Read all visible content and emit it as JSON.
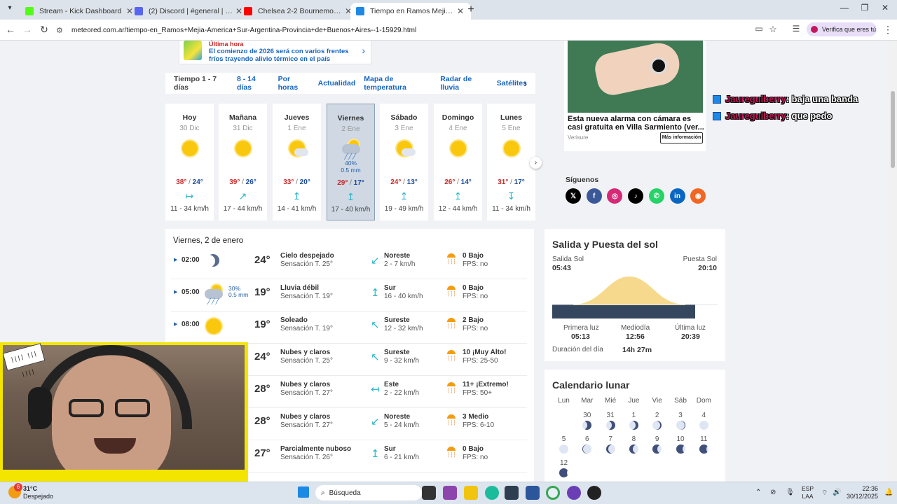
{
  "browser": {
    "tabs": [
      {
        "title": "Stream - Kick Dashboard",
        "color": "#53fc18"
      },
      {
        "title": "(2) Discord | #general | Liberisc",
        "color": "#5865f2"
      },
      {
        "title": "Chelsea 2-2 Bournemouth | HIG",
        "color": "#ff0000"
      },
      {
        "title": "Tiempo en Ramos Mejia. Clima",
        "color": "#1e88e5"
      }
    ],
    "url": "meteored.com.ar/tiempo-en_Ramos+Mejia-America+Sur-Argentina-Provincia+de+Buenos+Aires--1-15929.html",
    "profile_label": "Verifica que eres tú"
  },
  "news": {
    "tag": "Última hora",
    "headline": "El comienzo de 2026 será con varios frentes fríos trayendo alivio térmico en el país"
  },
  "subnav": [
    "Tiempo 1 - 7 días",
    "8 - 14 días",
    "Por horas",
    "Actualidad",
    "Mapa de temperatura",
    "Radar de lluvia",
    "Satélites"
  ],
  "days": [
    {
      "name": "Hoy",
      "date": "30 Dic",
      "icon": "sun",
      "hi": "38°",
      "lo": "24°",
      "wind_arrow": "↦",
      "wind": "11 - 34 km/h"
    },
    {
      "name": "Mañana",
      "date": "31 Dic",
      "icon": "sun",
      "hi": "39°",
      "lo": "26°",
      "wind_arrow": "↗",
      "wind": "17 - 44 km/h"
    },
    {
      "name": "Jueves",
      "date": "1 Ene",
      "icon": "sun-cloud",
      "hi": "33°",
      "lo": "20°",
      "wind_arrow": "↥",
      "wind": "14 - 41 km/h"
    },
    {
      "name": "Viernes",
      "date": "2 Ene",
      "icon": "rain",
      "precip": "40%",
      "precip_mm": "0.5 mm",
      "hi": "29°",
      "lo": "17°",
      "wind_arrow": "↥",
      "wind": "17 - 40 km/h"
    },
    {
      "name": "Sábado",
      "date": "3 Ene",
      "icon": "sun-cloud",
      "hi": "24°",
      "lo": "13°",
      "wind_arrow": "↥",
      "wind": "19 - 49 km/h"
    },
    {
      "name": "Domingo",
      "date": "4 Ene",
      "icon": "sun",
      "hi": "26°",
      "lo": "14°",
      "wind_arrow": "↥",
      "wind": "12 - 44 km/h"
    },
    {
      "name": "Lunes",
      "date": "5 Ene",
      "icon": "sun",
      "hi": "31°",
      "lo": "17°",
      "wind_arrow": "↧",
      "wind": "11 - 34 km/h"
    }
  ],
  "detail": {
    "title": "Viernes, 2 de enero",
    "rows": [
      {
        "time": "02:00",
        "icon": "moon",
        "temp": "24°",
        "cond": "Cielo despejado",
        "feel": "Sensación T. 25°",
        "arrow": "↙",
        "dir": "Noreste",
        "speed": "2 - 7 km/h",
        "uv": "0 Bajo",
        "fps": "FPS: no"
      },
      {
        "time": "05:00",
        "icon": "rain",
        "rain_pct": "30%",
        "rain_mm": "0.5 mm",
        "temp": "19°",
        "cond": "Lluvia débil",
        "feel": "Sensación T. 19°",
        "arrow": "↥",
        "dir": "Sur",
        "speed": "16 - 40 km/h",
        "uv": "0 Bajo",
        "fps": "FPS: no"
      },
      {
        "time": "08:00",
        "icon": "sun",
        "temp": "19°",
        "cond": "Soleado",
        "feel": "Sensación T. 19°",
        "arrow": "↖",
        "dir": "Sureste",
        "speed": "12 - 32 km/h",
        "uv": "2 Bajo",
        "fps": "FPS: no"
      },
      {
        "time": "",
        "icon": "",
        "temp": "24°",
        "cond": "Nubes y claros",
        "feel": "Sensación T. 25°",
        "arrow": "↖",
        "dir": "Sureste",
        "speed": "9 - 32 km/h",
        "uv": "10 ¡Muy Alto!",
        "fps": "FPS: 25-50"
      },
      {
        "time": "",
        "icon": "",
        "temp": "28°",
        "cond": "Nubes y claros",
        "feel": "Sensación T. 27°",
        "arrow": "↤",
        "dir": "Este",
        "speed": "2 - 22 km/h",
        "uv": "11+ ¡Extremo!",
        "fps": "FPS: 50+"
      },
      {
        "time": "",
        "icon": "",
        "temp": "28°",
        "cond": "Nubes y claros",
        "feel": "Sensación T. 27°",
        "arrow": "↙",
        "dir": "Noreste",
        "speed": "5 - 24 km/h",
        "uv": "3 Medio",
        "fps": "FPS: 6-10"
      },
      {
        "time": "",
        "icon": "",
        "temp": "27°",
        "cond": "Parcialmente nuboso",
        "feel": "Sensación T. 26°",
        "arrow": "↥",
        "dir": "Sur",
        "speed": "6 - 21 km/h",
        "uv": "0 Bajo",
        "fps": "FPS: no"
      }
    ]
  },
  "ad": {
    "title": "Esta nueva alarma con cámara es casi gratuita en Villa Sarmiento (ver...",
    "source": "Verisure",
    "button": "Más información"
  },
  "chat": [
    {
      "user": "Jaureguiberry",
      "msg": ": baja una banda"
    },
    {
      "user": "Jaureguiberry",
      "msg": ": que pedo"
    }
  ],
  "social": {
    "title": "Síguenos",
    "items": [
      {
        "name": "x",
        "glyph": "𝕏",
        "color": "#000000"
      },
      {
        "name": "facebook",
        "glyph": "f",
        "color": "#3b5998"
      },
      {
        "name": "instagram",
        "glyph": "◎",
        "color": "#d62976"
      },
      {
        "name": "tiktok",
        "glyph": "♪",
        "color": "#000000"
      },
      {
        "name": "whatsapp",
        "glyph": "✆",
        "color": "#25d366"
      },
      {
        "name": "linkedin",
        "glyph": "in",
        "color": "#0a66c2"
      },
      {
        "name": "rss",
        "glyph": "◉",
        "color": "#f26522"
      }
    ]
  },
  "sun": {
    "title": "Salida y Puesta del sol",
    "rise_label": "Salida Sol",
    "rise": "05:43",
    "set_label": "Puesta Sol",
    "set": "20:10",
    "first_light_label": "Primera luz",
    "first_light": "05:13",
    "noon_label": "Mediodía",
    "noon": "12:56",
    "last_light_label": "Última luz",
    "last_light": "20:39",
    "duration_label": "Duración del día",
    "duration": "14h 27m"
  },
  "moon": {
    "title": "Calendario lunar",
    "weekdays": [
      "Lun",
      "Mar",
      "Mié",
      "Jue",
      "Vie",
      "Sáb",
      "Dom"
    ],
    "days": [
      "30",
      "31",
      "1",
      "2",
      "3",
      "4",
      "5",
      "6",
      "7",
      "8",
      "9",
      "10",
      "11",
      "12"
    ]
  },
  "overlay": {
    "sticker": "|||| ||| ||||"
  },
  "taskbar": {
    "weather_temp": "31°C",
    "weather_desc": "Despejado",
    "search": "Búsqueda",
    "lang": "ESP",
    "lang2": "LAA",
    "time": "22:36",
    "date": "30/12/2025",
    "notif": "6"
  }
}
